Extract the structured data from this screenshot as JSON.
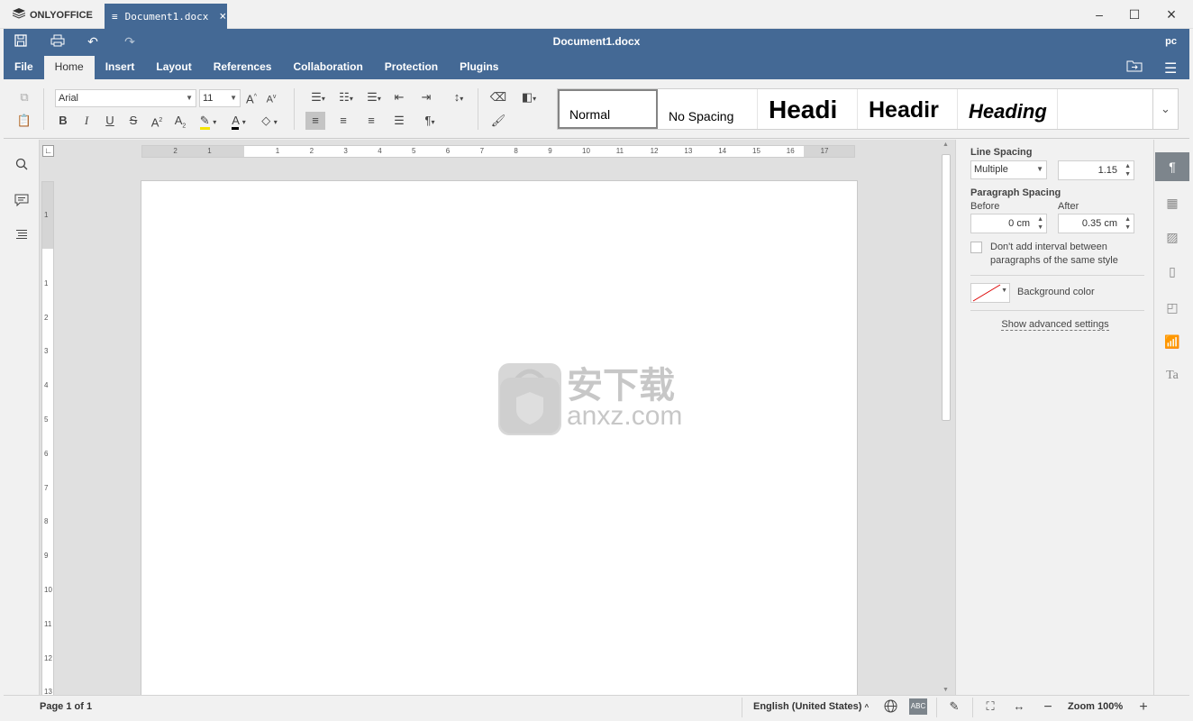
{
  "app": {
    "brand": "ONLYOFFICE",
    "tab_label": "Document1.docx",
    "doc_title": "Document1.docx",
    "user": "pc"
  },
  "menu": {
    "items": [
      "File",
      "Home",
      "Insert",
      "Layout",
      "References",
      "Collaboration",
      "Protection",
      "Plugins"
    ],
    "active": "Home"
  },
  "toolbar": {
    "font_name": "Arial",
    "font_size": "11",
    "styles": [
      "Normal",
      "No Spacing",
      "Headi",
      "Headir",
      "Heading"
    ]
  },
  "ruler": {
    "h_numbers": [
      "2",
      "1",
      "1",
      "2",
      "3",
      "4",
      "5",
      "6",
      "7",
      "8",
      "9",
      "10",
      "11",
      "12",
      "13",
      "14",
      "15",
      "16",
      "17"
    ],
    "v_numbers": [
      "1",
      "1",
      "2",
      "3",
      "4",
      "5",
      "6",
      "7",
      "8",
      "9",
      "10",
      "11",
      "12",
      "13"
    ]
  },
  "watermark": {
    "text": "安下载",
    "sub": "anxz.com"
  },
  "settings": {
    "line_spacing_label": "Line Spacing",
    "line_spacing_mode": "Multiple",
    "line_spacing_value": "1.15",
    "paragraph_spacing_label": "Paragraph Spacing",
    "before_label": "Before",
    "after_label": "After",
    "before_value": "0 cm",
    "after_value": "0.35 cm",
    "no_interval_label": "Don't add interval between paragraphs of the same style",
    "background_color_label": "Background color",
    "advanced_link": "Show advanced settings"
  },
  "status": {
    "page_info": "Page 1 of 1",
    "language": "English (United States)",
    "zoom": "Zoom 100%"
  },
  "colors": {
    "header": "#446995",
    "bg": "#f1f1f1"
  }
}
